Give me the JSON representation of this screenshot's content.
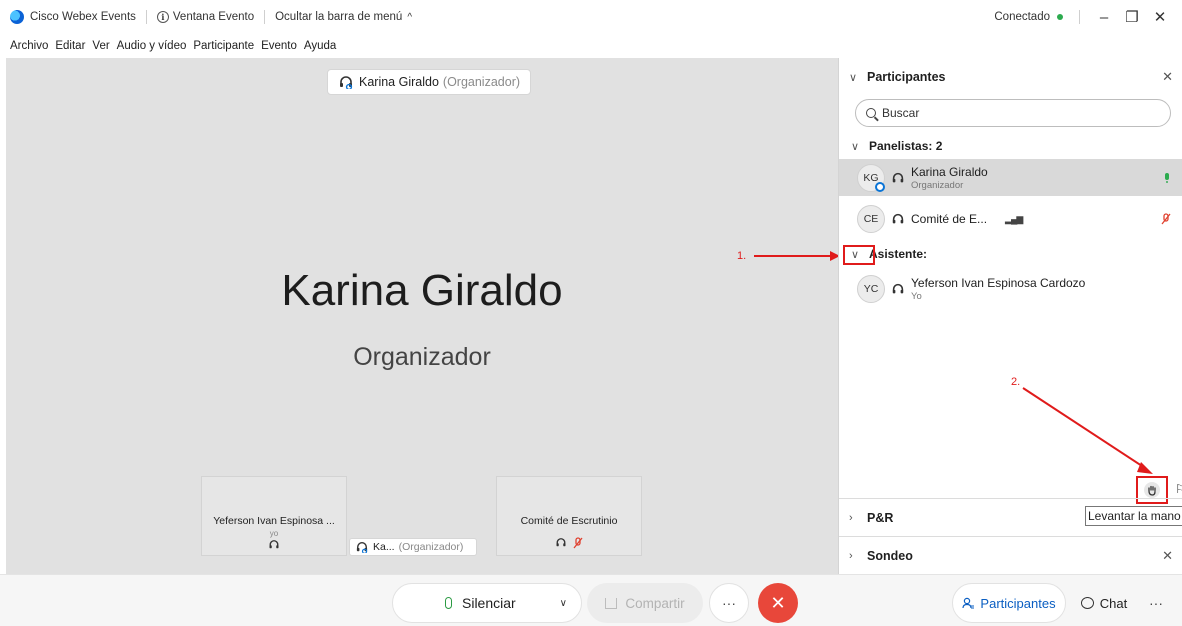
{
  "titlebar": {
    "app_name": "Cisco Webex Events",
    "event_window": "Ventana Evento",
    "hide_menu": "Ocultar la barra de menú",
    "status": "Conectado",
    "status_color": "#2cab4f"
  },
  "menu": [
    "Archivo",
    "Editar",
    "Ver",
    "Audio y vídeo",
    "Participante",
    "Evento",
    "Ayuda"
  ],
  "stage": {
    "speaker_name": "Karina Giraldo",
    "speaker_role": "(Organizador)",
    "big_name": "Karina Giraldo",
    "big_role": "Organizador",
    "thumb1_name": "Yeferson Ivan Espinosa ...",
    "thumb1_sub": "yo",
    "mini_name": "Ka...",
    "mini_role": "(Organizador)",
    "thumb3_name": "Comité de Escrutinio"
  },
  "panel": {
    "title": "Participantes",
    "search_placeholder": "Buscar",
    "panelists_label": "Panelistas: 2",
    "attendee_label": "Asistente:",
    "people": [
      {
        "initials": "KG",
        "name": "Karina Giraldo",
        "role": "Organizador"
      },
      {
        "initials": "CE",
        "name": "Comité de E...",
        "role": ""
      },
      {
        "initials": "YC",
        "name": "Yeferson Ivan Espinosa Cardozo",
        "role": "Yo"
      }
    ],
    "tooltip": "Levantar la mano",
    "qa_label": "P&R",
    "poll_label": "Sondeo"
  },
  "annotations": {
    "one": "1.",
    "two": "2.",
    "color": "#e01b1b"
  },
  "toolbar": {
    "mute": "Silenciar",
    "share": "Compartir",
    "participants": "Participantes",
    "chat": "Chat",
    "leave_color": "#e8473a",
    "accent": "#0a5ec2"
  }
}
